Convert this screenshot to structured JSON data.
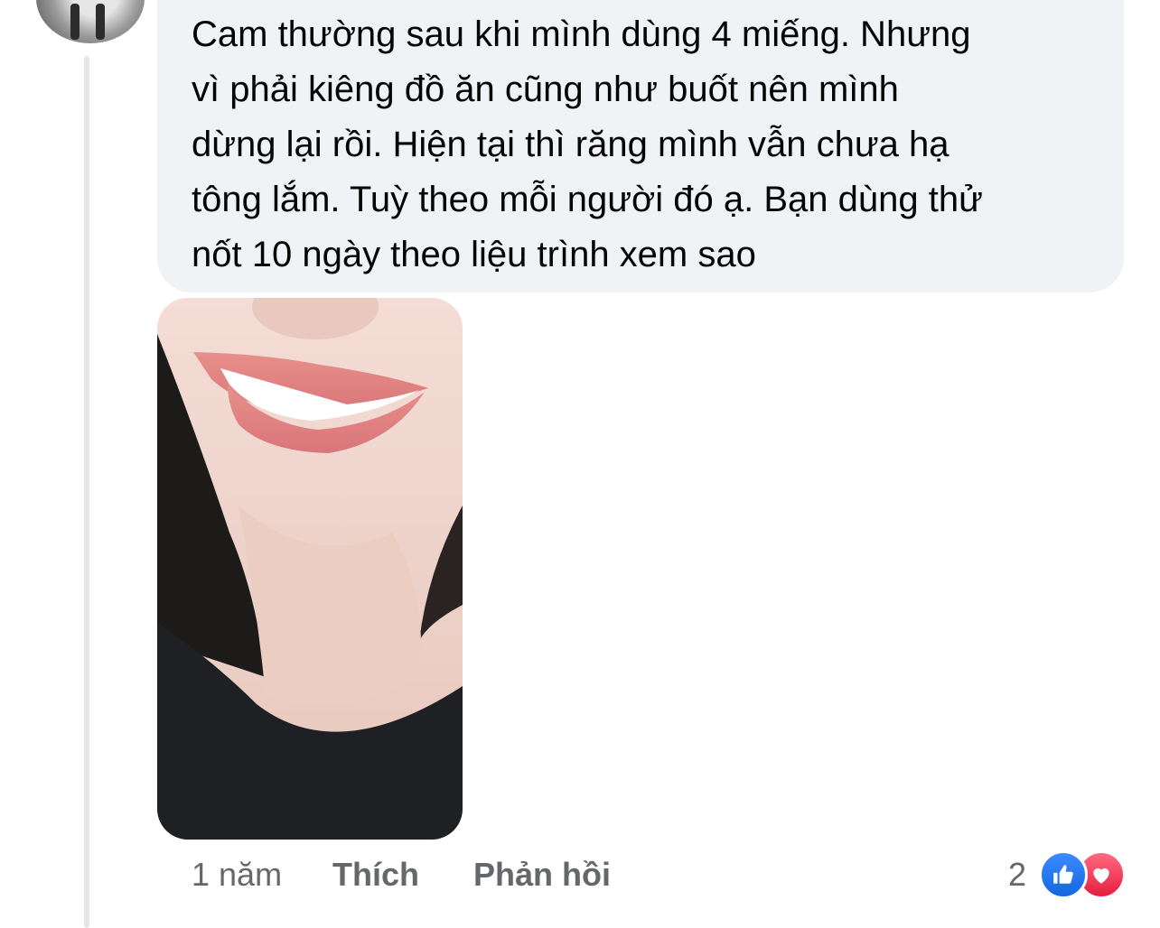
{
  "comment": {
    "text": "Cam thường sau khi mình dùng 4 miếng. Nhưng\nvì phải kiêng đồ ăn cũng như buốt nên mình\ndừng lại rồi. Hiện tại thì răng mình vẫn chưa hạ\ntông lắm. Tuỳ theo mỗi người đó ạ. Bạn dùng thử\nnốt 10 ngày theo liệu trình xem sao",
    "attachment_icon": "smile-photo"
  },
  "actions": {
    "time": "1 năm",
    "like_label": "Thích",
    "reply_label": "Phản hồi"
  },
  "reactions": {
    "count": "2",
    "types": [
      "like-icon",
      "love-icon"
    ],
    "colors": {
      "like": "#1877f2",
      "love": "#f33e58"
    }
  },
  "colors": {
    "bubble": "#f0f2f5",
    "text": "#050505",
    "meta": "#65676b"
  }
}
